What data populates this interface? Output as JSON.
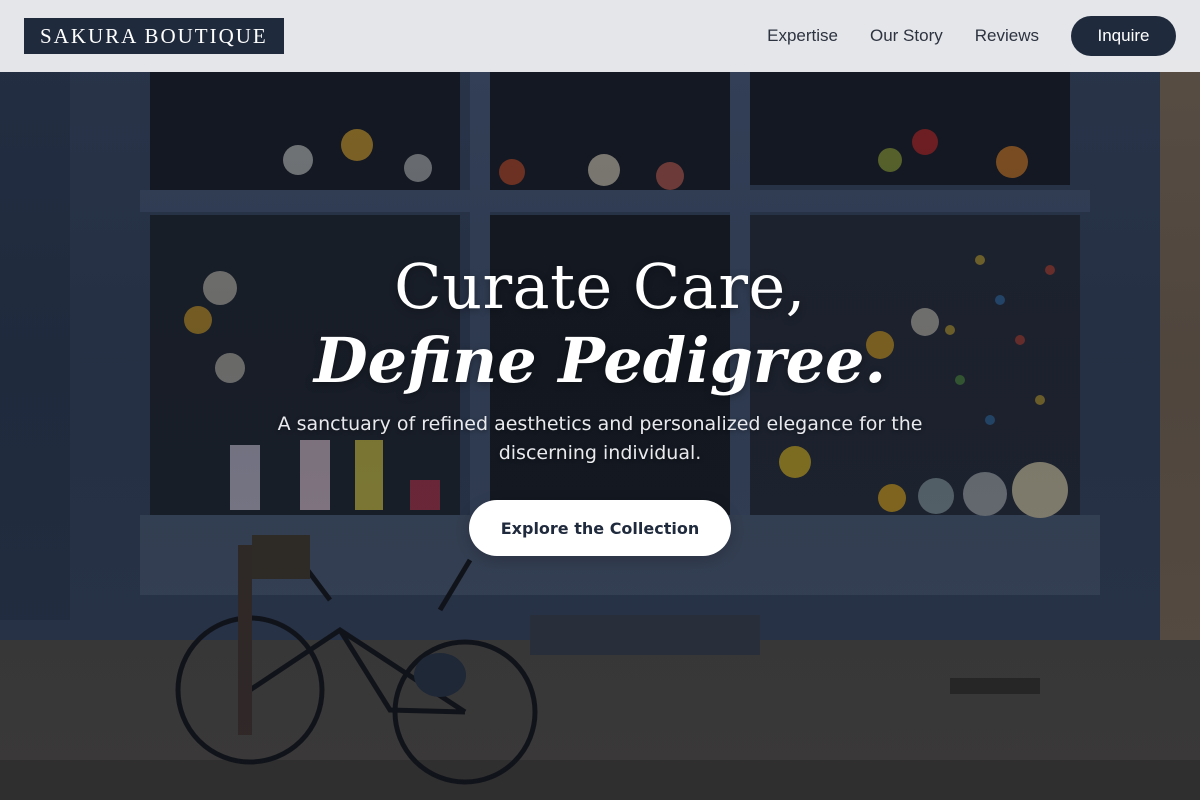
{
  "header": {
    "logo_text": "SAKURA BOUTIQUE",
    "nav": [
      {
        "label": "Expertise"
      },
      {
        "label": "Our Story"
      },
      {
        "label": "Reviews"
      }
    ],
    "inquire_label": "Inquire"
  },
  "hero": {
    "headline_line1": "Curate Care,",
    "headline_line2": "Define Pedigree.",
    "subtitle": "A sanctuary of refined aesthetics and personalized elegance for the discerning individual.",
    "cta_label": "Explore the Collection",
    "background_description_icon": "storefront-photo"
  },
  "colors": {
    "brand_navy": "#1f2a3d",
    "header_bg": "#f0f1f3",
    "cta_bg": "#ffffff"
  }
}
